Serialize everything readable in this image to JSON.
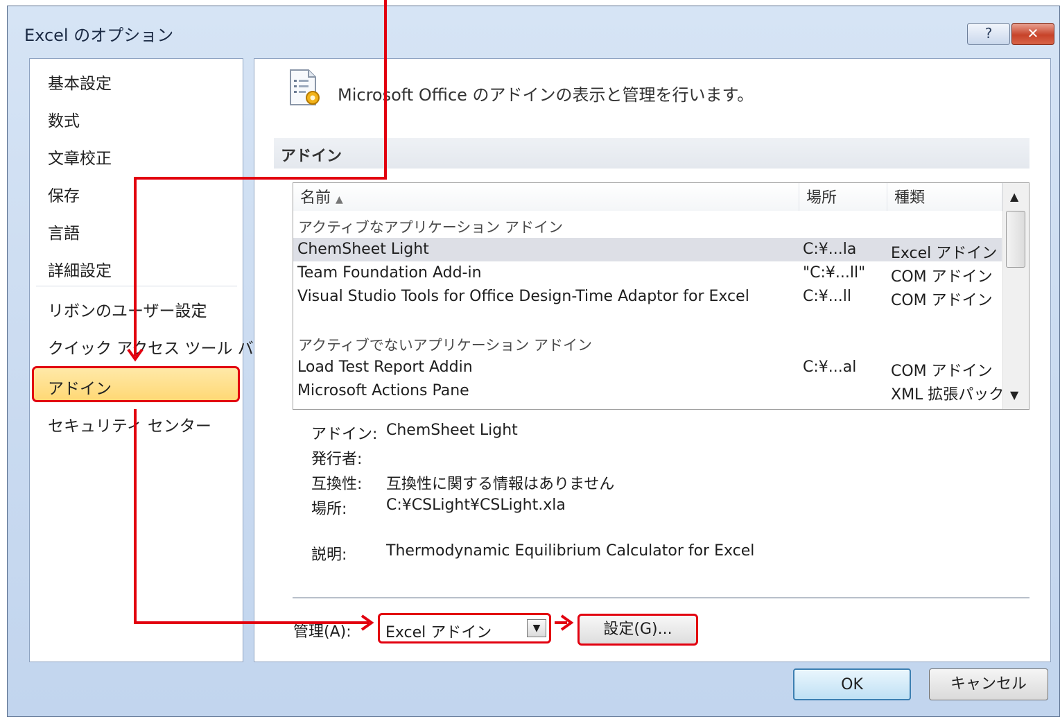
{
  "window": {
    "title": "Excel のオプション",
    "help_label": "?",
    "close_label": "✕"
  },
  "nav": {
    "items": [
      {
        "label": "基本設定"
      },
      {
        "label": "数式"
      },
      {
        "label": "文章校正"
      },
      {
        "label": "保存"
      },
      {
        "label": "言語"
      },
      {
        "label": "詳細設定"
      },
      {
        "label": "リボンのユーザー設定"
      },
      {
        "label": "クイック アクセス ツール バー"
      },
      {
        "label": "アドイン",
        "selected": true
      },
      {
        "label": "セキュリティ センター"
      }
    ]
  },
  "content": {
    "header_text": "Microsoft Office のアドインの表示と管理を行います。",
    "section_title": "アドイン",
    "columns": {
      "name": "名前",
      "location": "場所",
      "type": "種類"
    },
    "active_group": "アクティブなアプリケーション アドイン",
    "active_rows": [
      {
        "name": "ChemSheet Light",
        "location": "C:¥...la",
        "type": "Excel アドイン",
        "selected": true
      },
      {
        "name": "Team Foundation Add-in",
        "location": "\"C:¥...ll\"",
        "type": "COM アドイン"
      },
      {
        "name": "Visual Studio Tools for Office Design-Time Adaptor for Excel",
        "location": "C:¥...ll",
        "type": "COM アドイン"
      }
    ],
    "inactive_group": "アクティブでないアプリケーション アドイン",
    "inactive_rows": [
      {
        "name": "Load Test Report Addin",
        "location": "C:¥...al",
        "type": "COM アドイン"
      },
      {
        "name": "Microsoft Actions Pane",
        "location": "",
        "type": "XML 拡張パック"
      }
    ],
    "details": {
      "addin_label": "アドイン:",
      "addin_value": "ChemSheet Light",
      "publisher_label": "発行者:",
      "publisher_value": "",
      "compat_label": "互換性:",
      "compat_value": "互換性に関する情報はありません",
      "location_label": "場所:",
      "location_value": "C:¥CSLight¥CSLight.xla",
      "desc_label": "説明:",
      "desc_value": "Thermodynamic Equilibrium Calculator for Excel"
    },
    "manage": {
      "label": "管理(A):",
      "selected": "Excel アドイン",
      "go_label": "設定(G)..."
    }
  },
  "footer": {
    "ok_label": "OK",
    "cancel_label": "キャンセル"
  },
  "colors": {
    "highlight_border": "#e2000f",
    "selected_nav": "#ffd875"
  }
}
